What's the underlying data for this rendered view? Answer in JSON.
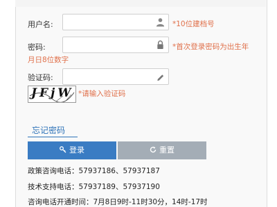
{
  "form": {
    "username": {
      "label": "用户名:",
      "value": "",
      "hint": "*10位建档号"
    },
    "password": {
      "label": "密码:",
      "value": "",
      "hint_line1": "*首次登录密码为出生年",
      "hint_line2": "月日8位数字"
    },
    "captcha": {
      "label": "验证码:",
      "value": "",
      "image_text": "JFjW",
      "hint": "*请输入验证码"
    }
  },
  "forgot_link": "忘记密码",
  "buttons": {
    "login": "登录",
    "reset": "重置"
  },
  "info": {
    "policy": "政策咨询电话：57937186、57937187",
    "tech": "技术支持电话：57937189、57937190",
    "hours": "咨询电话开通时间：7月8日9时-11时30分，14时-17时"
  },
  "icons": {
    "username": "user-icon",
    "password": "lock-icon",
    "captcha": "pencil-icon",
    "login": "key-icon",
    "reset": "refresh-icon"
  },
  "colors": {
    "hint": "#e0704a",
    "link": "#2e73b8",
    "login_button": "#3a7cc3",
    "reset_button": "#a4adb6"
  }
}
